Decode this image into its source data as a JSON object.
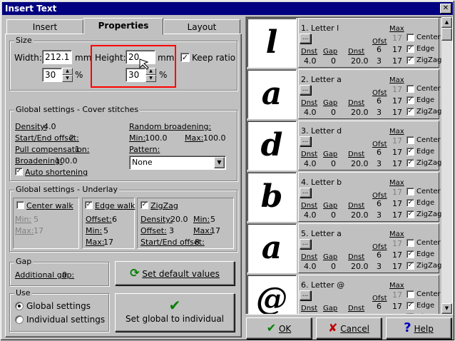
{
  "window": {
    "title": "Insert Text",
    "close_glyph": "✕"
  },
  "tabs": [
    {
      "label": "Insert"
    },
    {
      "label": "Properties"
    },
    {
      "label": "Layout"
    }
  ],
  "size": {
    "caption": "Size",
    "width_label": "Width:",
    "width_value": "212.1",
    "width_unit": "mm",
    "width_pct": "30",
    "pct_unit": "%",
    "height_label": "Height:",
    "height_value": "20",
    "height_unit": "mm",
    "height_pct": "30",
    "keep_ratio_label": "Keep ratio",
    "keep_ratio_checked": true
  },
  "cover": {
    "caption": "Global settings - Cover stitches",
    "density_label": "Density:",
    "density": "4.0",
    "offset_label": "Start/End offset:",
    "offset": "2",
    "pullcomp_label": "Pull compensation:",
    "pullcomp": "1",
    "broadening_label": "Broadening:",
    "broadening": "100.0",
    "auto_short_label": "Auto shortening",
    "auto_short_checked": true,
    "random_label": "Random broadening:",
    "min_label": "Min:",
    "min": "100.0",
    "max_label": "Max:",
    "max": "100.0",
    "pattern_label": "Pattern:",
    "pattern": "None"
  },
  "underlay": {
    "caption": "Global settings - Underlay",
    "center_label": "Center walk",
    "center_min_label": "Min:",
    "center_min": "5",
    "center_max_label": "Max:",
    "center_max": "17",
    "edge_label": "Edge walk",
    "edge_offset_label": "Offset:",
    "edge_offset": "6",
    "edge_min_label": "Min:",
    "edge_min": "5",
    "edge_max_label": "Max:",
    "edge_max": "17",
    "zz_label": "ZigZag",
    "zz_density_label": "Density:",
    "zz_density": "20.0",
    "zz_min_label": "Min:",
    "zz_min": "5",
    "zz_offset_label": "Offset:",
    "zz_offset": "3",
    "zz_max_label": "Max:",
    "zz_max": "17",
    "zz_se_label": "Start/End offset:",
    "zz_se": "8"
  },
  "gap": {
    "caption": "Gap",
    "additional_label": "Additional gap:",
    "additional": "0"
  },
  "set_default_label": "Set default values",
  "use": {
    "caption": "Use",
    "global_label": "Global settings",
    "individual_label": "Individual settings"
  },
  "set_global_label": "Set global to individual",
  "letters": [
    {
      "glyph": "l",
      "title": "1. Letter l",
      "dnst": "4.0",
      "gap": "0",
      "dnst2": "20.0",
      "ofst": "6",
      "max_top": "17",
      "max_b1": "17",
      "max_b2": "17",
      "ofst_b": "3"
    },
    {
      "glyph": "a",
      "title": "2. Letter a",
      "dnst": "4.0",
      "gap": "0",
      "dnst2": "20.0",
      "ofst": "6",
      "max_top": "17",
      "max_b1": "17",
      "max_b2": "17",
      "ofst_b": "3"
    },
    {
      "glyph": "d",
      "title": "3. Letter d",
      "dnst": "4.0",
      "gap": "0",
      "dnst2": "20.0",
      "ofst": "6",
      "max_top": "17",
      "max_b1": "17",
      "max_b2": "17",
      "ofst_b": "3"
    },
    {
      "glyph": "b",
      "title": "4. Letter b",
      "dnst": "4.0",
      "gap": "0",
      "dnst2": "20.0",
      "ofst": "6",
      "max_top": "17",
      "max_b1": "17",
      "max_b2": "17",
      "ofst_b": "3"
    },
    {
      "glyph": "a",
      "title": "5. Letter a",
      "dnst": "4.0",
      "gap": "0",
      "dnst2": "20.0",
      "ofst": "6",
      "max_top": "17",
      "max_b1": "17",
      "max_b2": "17",
      "ofst_b": "3"
    },
    {
      "glyph": "@",
      "title": "6. Letter @",
      "dnst": "4.0",
      "gap": "0",
      "dnst2": "20.0",
      "ofst": "6",
      "max_top": "17",
      "max_b1": "17",
      "max_b2": "17",
      "ofst_b": "3"
    }
  ],
  "letter_labels": {
    "dnst": "Dnst",
    "gap": "Gap",
    "ofst": "Ofst",
    "max": "Max",
    "center": "Center",
    "edge": "Edge",
    "zigzag": "ZigZag",
    "more": "..."
  },
  "footer": {
    "ok": "OK",
    "cancel": "Cancel",
    "help": "Help"
  },
  "colors": {
    "titlebar": "#000080",
    "highlight": "#ff0000",
    "ok_check": "#008000",
    "cancel_x": "#c00000",
    "help_q": "#0000c0"
  }
}
